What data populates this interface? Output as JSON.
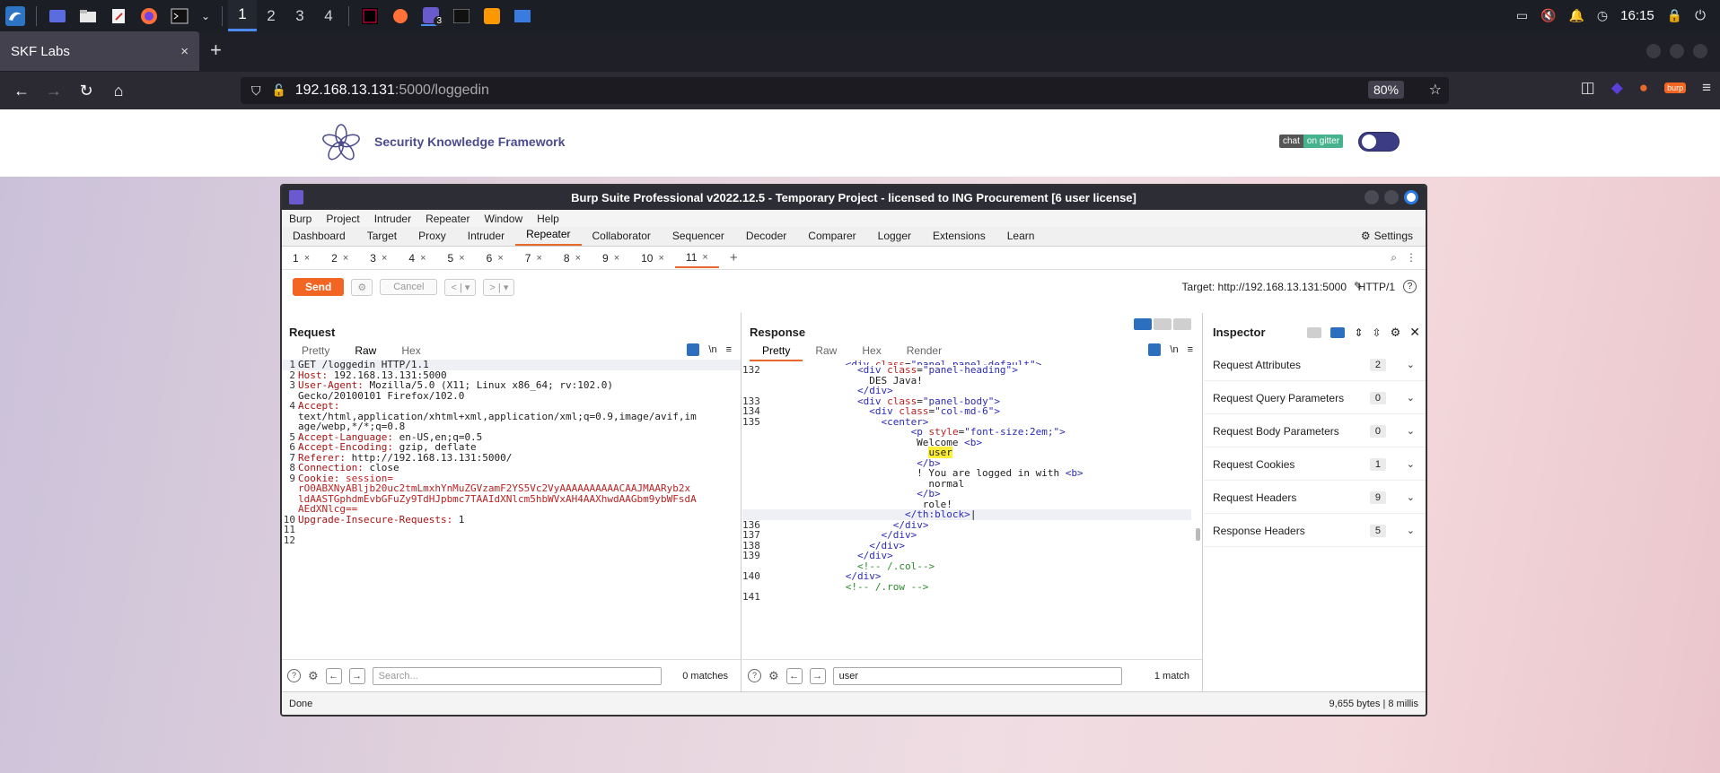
{
  "taskbar": {
    "workspaces": [
      "1",
      "2",
      "3",
      "4"
    ],
    "badge": "3",
    "clock": "16:15"
  },
  "browser": {
    "tab_title": "SKF Labs",
    "tab_close": "×",
    "new_tab": "+",
    "url_host": "192.168.13.131",
    "url_rest": ":5000/loggedin",
    "zoom": "80%",
    "burp_badge": "burp"
  },
  "skf": {
    "title": "Security Knowledge Framework",
    "chat_label": "chat",
    "gitter_label": "on gitter"
  },
  "burp": {
    "title": "Burp Suite Professional v2022.12.5 - Temporary Project - licensed to ING Procurement [6 user license]",
    "menu": [
      "Burp",
      "Project",
      "Intruder",
      "Repeater",
      "Window",
      "Help"
    ],
    "tools": [
      "Dashboard",
      "Target",
      "Proxy",
      "Intruder",
      "Repeater",
      "Collaborator",
      "Sequencer",
      "Decoder",
      "Comparer",
      "Logger",
      "Extensions",
      "Learn"
    ],
    "active_tool": "Repeater",
    "settings_label": "Settings",
    "repeater_tabs": [
      "1",
      "2",
      "3",
      "4",
      "5",
      "6",
      "7",
      "8",
      "9",
      "10",
      "11"
    ],
    "active_repeater_tab": "11",
    "tab_close": "×",
    "add_tab": "+",
    "send_label": "Send",
    "cancel_label": "Cancel",
    "prev_label": "<",
    "next_label": ">",
    "dropdown": "▾",
    "target_label": "Target: http://192.168.13.131:5000",
    "http_version": "HTTP/1",
    "request": {
      "title": "Request",
      "view_tabs": [
        "Pretty",
        "Raw",
        "Hex"
      ],
      "active_view": "Raw",
      "newline_toggle": "\\n",
      "search_placeholder": "Search...",
      "matches": "0 matches"
    },
    "response": {
      "title": "Response",
      "view_tabs": [
        "Pretty",
        "Raw",
        "Hex",
        "Render"
      ],
      "active_view": "Pretty",
      "newline_toggle": "\\n",
      "search_value": "user",
      "matches": "1 match"
    },
    "inspector": {
      "title": "Inspector",
      "rows": [
        {
          "label": "Request Attributes",
          "count": "2"
        },
        {
          "label": "Request Query Parameters",
          "count": "0"
        },
        {
          "label": "Request Body Parameters",
          "count": "0"
        },
        {
          "label": "Request Cookies",
          "count": "1"
        },
        {
          "label": "Request Headers",
          "count": "9"
        },
        {
          "label": "Response Headers",
          "count": "5"
        }
      ]
    },
    "status_left": "Done",
    "status_right": "9,655 bytes | 8 millis"
  }
}
